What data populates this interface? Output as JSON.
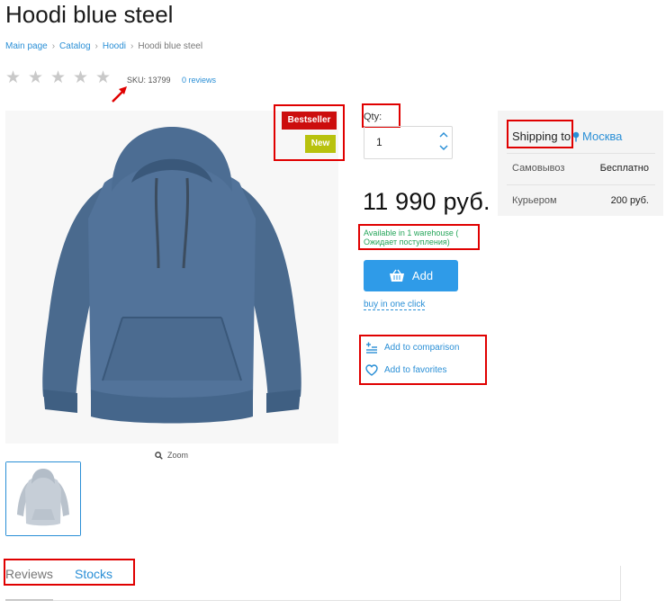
{
  "product": {
    "title": "Hoodi blue steel",
    "sku_text": "SKU: 13799",
    "reviews_link": "0 reviews",
    "rating": 0,
    "rating_max": 5,
    "zoom_label": "Zoom",
    "badges": {
      "bestseller": "Bestseller",
      "new": "New"
    },
    "colors": {
      "bestseller": "#cc0d0d",
      "new": "#b8c20e",
      "accent": "#2f9be8",
      "available": "#26a55a",
      "highlight": "#e00000"
    }
  },
  "breadcrumb": {
    "items": [
      "Main page",
      "Catalog",
      "Hoodi"
    ],
    "current": "Hoodi blue steel",
    "separator": ">"
  },
  "purchase": {
    "qty_label": "Qty:",
    "qty_value": "1",
    "price": "11 990 руб.",
    "availability_line1": "Available in 1 warehouse (",
    "availability_line2": "Ожидает поступления)",
    "add_button": "Add",
    "one_click": "buy in one click",
    "compare": "Add to comparison",
    "favorites": "Add to favorites"
  },
  "shipping": {
    "title": "Shipping to",
    "city": "Москва",
    "rows": [
      {
        "label": "Самовывоз",
        "value": "Бесплатно"
      },
      {
        "label": "Курьером",
        "value": "200 руб."
      }
    ]
  },
  "tabs": {
    "reviews": "Reviews",
    "stocks": "Stocks"
  }
}
